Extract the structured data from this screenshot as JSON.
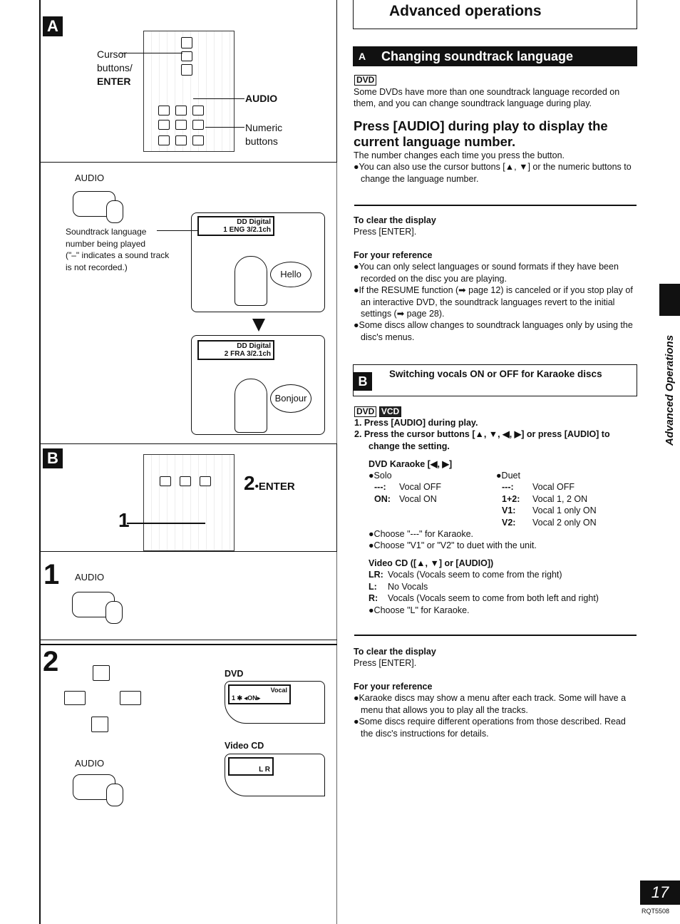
{
  "section_a_left": {
    "label": "A",
    "cursor": "Cursor",
    "buttons": "buttons/",
    "enter": "ENTER",
    "audio": "AUDIO",
    "numeric": "Numeric",
    "numeric2": "buttons"
  },
  "audio_label": "AUDIO",
  "soundtrack_note": [
    "Soundtrack language",
    "number being played",
    "(\"–\" indicates a sound track",
    "is not recorded.)"
  ],
  "screen1": {
    "line1": "DD Digital",
    "line2": "1 ENG  3/2.1ch",
    "speech": "Hello"
  },
  "screen2": {
    "line1": "DD Digital",
    "line2": "2 FRA  3/2.1ch",
    "speech": "Bonjour"
  },
  "section_b_left": {
    "label": "B",
    "step2": "2",
    "step2_suffix": "•ENTER",
    "step1": "1"
  },
  "step1": {
    "num": "1",
    "audio": "AUDIO"
  },
  "step2": {
    "num": "2",
    "audio": "AUDIO",
    "dvd": "DVD",
    "dvd_osd1": "Vocal",
    "dvd_osd2": "1 ✱    ◂ON▸",
    "vcd": "Video CD",
    "vcd_osd": "L R"
  },
  "header": {
    "title": "Advanced operations"
  },
  "banner": {
    "letter": "A",
    "title": "Changing soundtrack language"
  },
  "dvd_tag": "DVD",
  "vcd_tag": "VCD",
  "intro": "Some DVDs have more than one soundtrack language recorded on them, and you can change soundtrack language during play.",
  "heading": "Press [AUDIO] during play to display the current language number.",
  "heading_note": "The number changes each time you press the button.",
  "heading_bullet": "●You can also use the cursor buttons [▲, ▼] or the numeric buttons to change the language number.",
  "clear1": {
    "title": "To clear the display",
    "text": "Press [ENTER]."
  },
  "ref1": {
    "title": "For your reference",
    "items": [
      "●You can only select languages or sound formats if they have been recorded on the disc you are playing.",
      "●If the RESUME function (➡ page 12) is canceled or if you stop play of an interactive DVD, the soundtrack languages revert to the initial settings (➡ page 28).",
      "●Some discs allow changes to soundtrack languages only by using the disc's menus."
    ]
  },
  "karaoke": {
    "letter": "B",
    "title": "Switching vocals ON or OFF for Karaoke discs",
    "steps": [
      "1.  Press [AUDIO] during play.",
      "2.  Press the cursor buttons [▲, ▼, ◀, ▶] or press [AUDIO] to change the setting."
    ],
    "dvd_title": "DVD Karaoke [◀, ▶]",
    "solo": {
      "title": "●Solo",
      "rows": [
        [
          "---:",
          "Vocal OFF"
        ],
        [
          "ON:",
          "Vocal ON"
        ]
      ]
    },
    "duet": {
      "title": "●Duet",
      "rows": [
        [
          "---:",
          "Vocal OFF"
        ],
        [
          "1+2:",
          "Vocal 1, 2 ON"
        ],
        [
          "V1:",
          "Vocal 1 only ON"
        ],
        [
          "V2:",
          "Vocal 2 only ON"
        ]
      ]
    },
    "notes": [
      "●Choose \"---\" for Karaoke.",
      "●Choose \"V1\" or \"V2\" to duet with the unit."
    ],
    "vcd_title": "Video CD ([▲, ▼] or [AUDIO])",
    "vcd_rows": [
      [
        "LR:",
        "Vocals (Vocals seem to come from the right)"
      ],
      [
        "L:",
        "No Vocals"
      ],
      [
        "R:",
        "Vocals (Vocals seem to come from both left and right)"
      ]
    ],
    "vcd_note": "●Choose \"L\" for Karaoke."
  },
  "clear2": {
    "title": "To clear the display",
    "text": "Press [ENTER]."
  },
  "ref2": {
    "title": "For your reference",
    "items": [
      "●Karaoke discs may show a menu after each track. Some will have a menu that allows you to play all the tracks.",
      "●Some discs require different operations from those described. Read the disc's instructions for details."
    ]
  },
  "side_tab": "Advanced Operations",
  "page_number": "17",
  "doc_code": "RQT5508"
}
